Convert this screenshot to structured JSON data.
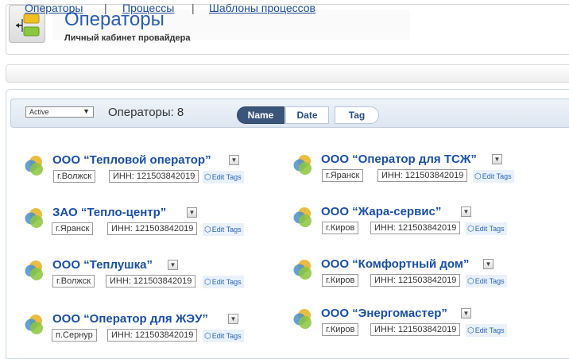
{
  "header": {
    "title": "Операторы",
    "subtitle": "Личный кабинет провайдера"
  },
  "nav": {
    "items": [
      "Операторы",
      "Процессы",
      "Шаблоны процессов"
    ],
    "separator": "|"
  },
  "toolbar": {
    "filter_value": "Active",
    "count_label": "Операторы:",
    "count_value": "8",
    "sort_buttons": [
      "Name",
      "Date",
      "Tag"
    ],
    "active_sort": "Name"
  },
  "operators": [
    {
      "name": "ООО “Тепловой оператор”",
      "city": "г.Волжск",
      "inn": "ИНН: 121503842019",
      "edit": "Edit Tags"
    },
    {
      "name": "ООО “Оператор для ТСЖ”",
      "city": "г.Яранск",
      "inn": "ИНН: 121503842019",
      "edit": "Edit Tags"
    },
    {
      "name": "ЗАО “Тепло-центр”",
      "city": "г.Яранск",
      "inn": "ИНН: 121503842019",
      "edit": "Edit Tags"
    },
    {
      "name": "ООО “Жара-сервис”",
      "city": "г.Киров",
      "inn": "ИНН: 121503842019",
      "edit": "Edit Tags"
    },
    {
      "name": "ООО “Теплушка”",
      "city": "г.Волжск",
      "inn": "ИНН: 121503842019",
      "edit": "Edit Tags"
    },
    {
      "name": "ООО “Комфортный дом”",
      "city": "г.Киров",
      "inn": "ИНН: 121503842019",
      "edit": "Edit Tags"
    },
    {
      "name": "ООО “Оператор для ЖЭУ”",
      "city": "п.Сернур",
      "inn": "ИНН: 121503842019",
      "edit": "Edit Tags"
    },
    {
      "name": "ООО “Энергомастер”",
      "city": "г.Киров",
      "inn": "ИНН: 121503842019",
      "edit": "Edit Tags"
    }
  ],
  "icons": {
    "logo": "process-flow-icon",
    "avatar": "operator-circles-icon",
    "dropdown": "chevron-down-icon",
    "edit_tags": "tag-icon"
  },
  "colors": {
    "title": "#2a5db0",
    "link": "#1b4fa3",
    "sort_active_bg": "#3b5479",
    "edit_tags_bg": "#e9f1fb"
  }
}
